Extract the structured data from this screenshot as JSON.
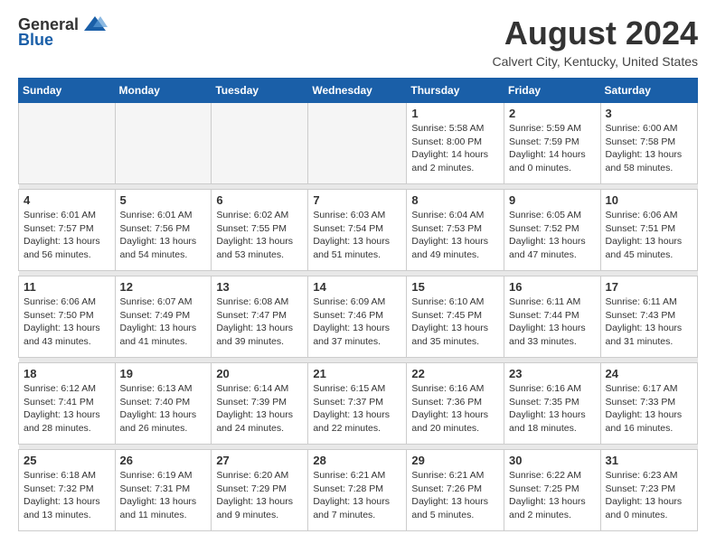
{
  "header": {
    "logo_general": "General",
    "logo_blue": "Blue",
    "title": "August 2024",
    "location": "Calvert City, Kentucky, United States"
  },
  "calendar": {
    "days_of_week": [
      "Sunday",
      "Monday",
      "Tuesday",
      "Wednesday",
      "Thursday",
      "Friday",
      "Saturday"
    ],
    "weeks": [
      [
        {
          "day": "",
          "info": ""
        },
        {
          "day": "",
          "info": ""
        },
        {
          "day": "",
          "info": ""
        },
        {
          "day": "",
          "info": ""
        },
        {
          "day": "1",
          "info": "Sunrise: 5:58 AM\nSunset: 8:00 PM\nDaylight: 14 hours\nand 2 minutes."
        },
        {
          "day": "2",
          "info": "Sunrise: 5:59 AM\nSunset: 7:59 PM\nDaylight: 14 hours\nand 0 minutes."
        },
        {
          "day": "3",
          "info": "Sunrise: 6:00 AM\nSunset: 7:58 PM\nDaylight: 13 hours\nand 58 minutes."
        }
      ],
      [
        {
          "day": "4",
          "info": "Sunrise: 6:01 AM\nSunset: 7:57 PM\nDaylight: 13 hours\nand 56 minutes."
        },
        {
          "day": "5",
          "info": "Sunrise: 6:01 AM\nSunset: 7:56 PM\nDaylight: 13 hours\nand 54 minutes."
        },
        {
          "day": "6",
          "info": "Sunrise: 6:02 AM\nSunset: 7:55 PM\nDaylight: 13 hours\nand 53 minutes."
        },
        {
          "day": "7",
          "info": "Sunrise: 6:03 AM\nSunset: 7:54 PM\nDaylight: 13 hours\nand 51 minutes."
        },
        {
          "day": "8",
          "info": "Sunrise: 6:04 AM\nSunset: 7:53 PM\nDaylight: 13 hours\nand 49 minutes."
        },
        {
          "day": "9",
          "info": "Sunrise: 6:05 AM\nSunset: 7:52 PM\nDaylight: 13 hours\nand 47 minutes."
        },
        {
          "day": "10",
          "info": "Sunrise: 6:06 AM\nSunset: 7:51 PM\nDaylight: 13 hours\nand 45 minutes."
        }
      ],
      [
        {
          "day": "11",
          "info": "Sunrise: 6:06 AM\nSunset: 7:50 PM\nDaylight: 13 hours\nand 43 minutes."
        },
        {
          "day": "12",
          "info": "Sunrise: 6:07 AM\nSunset: 7:49 PM\nDaylight: 13 hours\nand 41 minutes."
        },
        {
          "day": "13",
          "info": "Sunrise: 6:08 AM\nSunset: 7:47 PM\nDaylight: 13 hours\nand 39 minutes."
        },
        {
          "day": "14",
          "info": "Sunrise: 6:09 AM\nSunset: 7:46 PM\nDaylight: 13 hours\nand 37 minutes."
        },
        {
          "day": "15",
          "info": "Sunrise: 6:10 AM\nSunset: 7:45 PM\nDaylight: 13 hours\nand 35 minutes."
        },
        {
          "day": "16",
          "info": "Sunrise: 6:11 AM\nSunset: 7:44 PM\nDaylight: 13 hours\nand 33 minutes."
        },
        {
          "day": "17",
          "info": "Sunrise: 6:11 AM\nSunset: 7:43 PM\nDaylight: 13 hours\nand 31 minutes."
        }
      ],
      [
        {
          "day": "18",
          "info": "Sunrise: 6:12 AM\nSunset: 7:41 PM\nDaylight: 13 hours\nand 28 minutes."
        },
        {
          "day": "19",
          "info": "Sunrise: 6:13 AM\nSunset: 7:40 PM\nDaylight: 13 hours\nand 26 minutes."
        },
        {
          "day": "20",
          "info": "Sunrise: 6:14 AM\nSunset: 7:39 PM\nDaylight: 13 hours\nand 24 minutes."
        },
        {
          "day": "21",
          "info": "Sunrise: 6:15 AM\nSunset: 7:37 PM\nDaylight: 13 hours\nand 22 minutes."
        },
        {
          "day": "22",
          "info": "Sunrise: 6:16 AM\nSunset: 7:36 PM\nDaylight: 13 hours\nand 20 minutes."
        },
        {
          "day": "23",
          "info": "Sunrise: 6:16 AM\nSunset: 7:35 PM\nDaylight: 13 hours\nand 18 minutes."
        },
        {
          "day": "24",
          "info": "Sunrise: 6:17 AM\nSunset: 7:33 PM\nDaylight: 13 hours\nand 16 minutes."
        }
      ],
      [
        {
          "day": "25",
          "info": "Sunrise: 6:18 AM\nSunset: 7:32 PM\nDaylight: 13 hours\nand 13 minutes."
        },
        {
          "day": "26",
          "info": "Sunrise: 6:19 AM\nSunset: 7:31 PM\nDaylight: 13 hours\nand 11 minutes."
        },
        {
          "day": "27",
          "info": "Sunrise: 6:20 AM\nSunset: 7:29 PM\nDaylight: 13 hours\nand 9 minutes."
        },
        {
          "day": "28",
          "info": "Sunrise: 6:21 AM\nSunset: 7:28 PM\nDaylight: 13 hours\nand 7 minutes."
        },
        {
          "day": "29",
          "info": "Sunrise: 6:21 AM\nSunset: 7:26 PM\nDaylight: 13 hours\nand 5 minutes."
        },
        {
          "day": "30",
          "info": "Sunrise: 6:22 AM\nSunset: 7:25 PM\nDaylight: 13 hours\nand 2 minutes."
        },
        {
          "day": "31",
          "info": "Sunrise: 6:23 AM\nSunset: 7:23 PM\nDaylight: 13 hours\nand 0 minutes."
        }
      ]
    ]
  }
}
